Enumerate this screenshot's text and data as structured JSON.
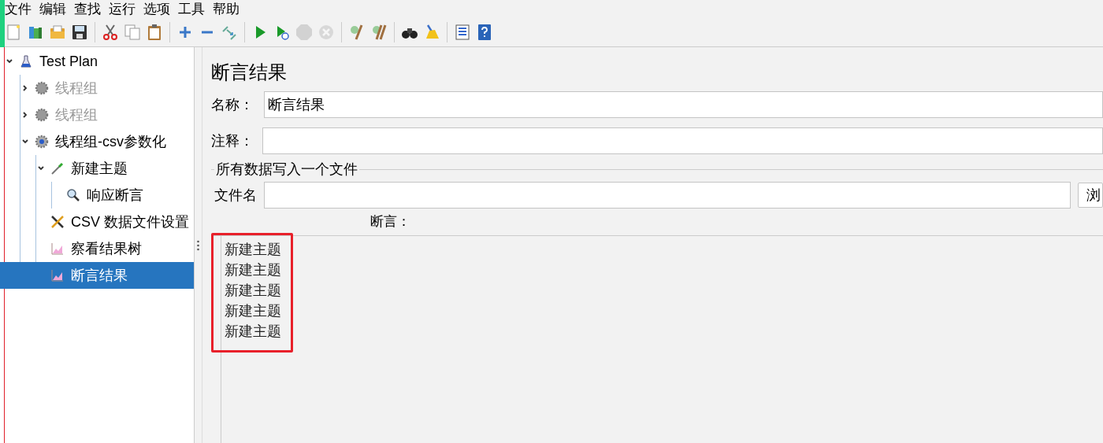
{
  "menu": [
    "文件",
    "编辑",
    "查找",
    "运行",
    "选项",
    "工具",
    "帮助"
  ],
  "toolbar": [
    {
      "kind": "new",
      "disabled": false
    },
    {
      "kind": "templates",
      "disabled": false
    },
    {
      "kind": "open",
      "disabled": false
    },
    {
      "kind": "save",
      "disabled": false
    },
    {
      "kind": "sep"
    },
    {
      "kind": "cut",
      "disabled": false
    },
    {
      "kind": "copy",
      "disabled": false
    },
    {
      "kind": "paste",
      "disabled": false
    },
    {
      "kind": "sep"
    },
    {
      "kind": "expand",
      "disabled": false
    },
    {
      "kind": "collapse",
      "disabled": false
    },
    {
      "kind": "toggle",
      "disabled": false
    },
    {
      "kind": "sep"
    },
    {
      "kind": "start",
      "disabled": false
    },
    {
      "kind": "start-no-pause",
      "disabled": false
    },
    {
      "kind": "stop",
      "disabled": true
    },
    {
      "kind": "shutdown",
      "disabled": true
    },
    {
      "kind": "sep"
    },
    {
      "kind": "clear",
      "disabled": false
    },
    {
      "kind": "clear-all",
      "disabled": false
    },
    {
      "kind": "sep"
    },
    {
      "kind": "search",
      "disabled": false
    },
    {
      "kind": "reset-search",
      "disabled": false
    },
    {
      "kind": "sep"
    },
    {
      "kind": "function-helper",
      "disabled": false
    },
    {
      "kind": "help",
      "disabled": false
    }
  ],
  "tree": [
    {
      "label": "Test Plan",
      "kind": "plan",
      "expanded": true,
      "disabled": false,
      "selected": false,
      "children": [
        {
          "label": "线程组",
          "kind": "thread-group",
          "expanded": false,
          "disabled": true,
          "selected": false
        },
        {
          "label": "线程组",
          "kind": "thread-group",
          "expanded": false,
          "disabled": true,
          "selected": false
        },
        {
          "label": "线程组-csv参数化",
          "kind": "thread-group",
          "expanded": true,
          "disabled": false,
          "selected": false,
          "children": [
            {
              "label": "新建主题",
              "kind": "sampler",
              "expanded": true,
              "disabled": false,
              "selected": false,
              "children": [
                {
                  "label": "响应断言",
                  "kind": "assertion",
                  "disabled": false,
                  "selected": false
                }
              ]
            },
            {
              "label": "CSV 数据文件设置",
              "kind": "config",
              "disabled": false,
              "selected": false
            },
            {
              "label": "察看结果树",
              "kind": "listener",
              "disabled": false,
              "selected": false
            },
            {
              "label": "断言结果",
              "kind": "listener",
              "disabled": false,
              "selected": true
            }
          ]
        }
      ]
    }
  ],
  "panel": {
    "title": "断言结果",
    "name_label": "名称：",
    "name_value": "断言结果",
    "comment_label": "注释：",
    "file_group": "所有数据写入一个文件",
    "filename_label": "文件名",
    "browse_button": "浏",
    "assertions_label": "断言：",
    "results": [
      "新建主题",
      "新建主题",
      "新建主题",
      "新建主题",
      "新建主题"
    ]
  }
}
